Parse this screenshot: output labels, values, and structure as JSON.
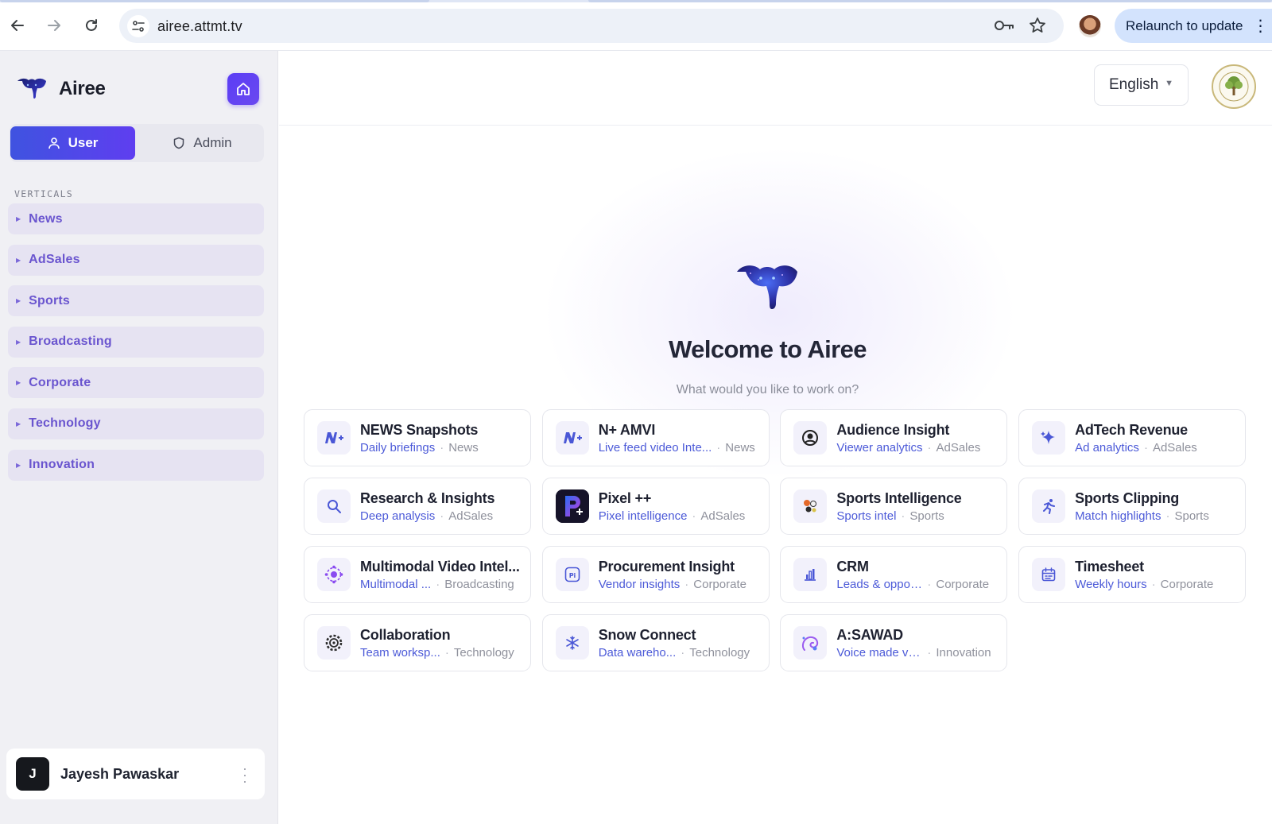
{
  "browser": {
    "url": "airee.attmt.tv",
    "relaunch_label": "Relaunch to update"
  },
  "sidebar": {
    "brand": "Airee",
    "roles": {
      "user": "User",
      "admin": "Admin"
    },
    "verticals_label": "VERTICALS",
    "verticals": [
      {
        "label": "News"
      },
      {
        "label": "AdSales"
      },
      {
        "label": "Sports"
      },
      {
        "label": "Broadcasting"
      },
      {
        "label": "Corporate"
      },
      {
        "label": "Technology"
      },
      {
        "label": "Innovation"
      }
    ],
    "user": {
      "initial": "J",
      "name": "Jayesh Pawaskar"
    }
  },
  "main": {
    "language": "English",
    "welcome": "Welcome to Airee",
    "subtitle": "What would you like to work on?",
    "cards": [
      {
        "title": "NEWS Snapshots",
        "desc": "Daily briefings",
        "category": "News",
        "icon": "news-icon"
      },
      {
        "title": "N+ AMVI",
        "desc": "Live feed video Inte...",
        "category": "News",
        "icon": "news-icon"
      },
      {
        "title": "Audience Insight",
        "desc": "Viewer analytics",
        "category": "AdSales",
        "icon": "eye-icon"
      },
      {
        "title": "AdTech Revenue",
        "desc": "Ad analytics",
        "category": "AdSales",
        "icon": "sparkle-icon"
      },
      {
        "title": "Research & Insights",
        "desc": "Deep analysis",
        "category": "AdSales",
        "icon": "search-icon"
      },
      {
        "title": "Pixel ++",
        "desc": "Pixel intelligence",
        "category": "AdSales",
        "icon": "pixel-app-icon"
      },
      {
        "title": "Sports Intelligence",
        "desc": "Sports intel",
        "category": "Sports",
        "icon": "sports-balls-icon"
      },
      {
        "title": "Sports Clipping",
        "desc": "Match highlights",
        "category": "Sports",
        "icon": "runner-icon"
      },
      {
        "title": "Multimodal Video Intel...",
        "desc": "Multimodal ...",
        "category": "Broadcasting",
        "icon": "atom-icon"
      },
      {
        "title": "Procurement Insight",
        "desc": "Vendor insights",
        "category": "Corporate",
        "icon": "pi-icon"
      },
      {
        "title": "CRM",
        "desc": "Leads & oppor...",
        "category": "Corporate",
        "icon": "bar-chart-icon"
      },
      {
        "title": "Timesheet",
        "desc": "Weekly hours",
        "category": "Corporate",
        "icon": "calendar-icon"
      },
      {
        "title": "Collaboration",
        "desc": "Team worksp...",
        "category": "Technology",
        "icon": "gear-icon"
      },
      {
        "title": "Snow Connect",
        "desc": "Data wareho...",
        "category": "Technology",
        "icon": "snowflake-icon"
      },
      {
        "title": "A:SAWAD",
        "desc": "Voice made vis...",
        "category": "Innovation",
        "icon": "voice-icon"
      }
    ]
  },
  "colors": {
    "accent": "#5b3df5",
    "link": "#4c5ad8",
    "sidebar_item": "#6a55cf"
  }
}
